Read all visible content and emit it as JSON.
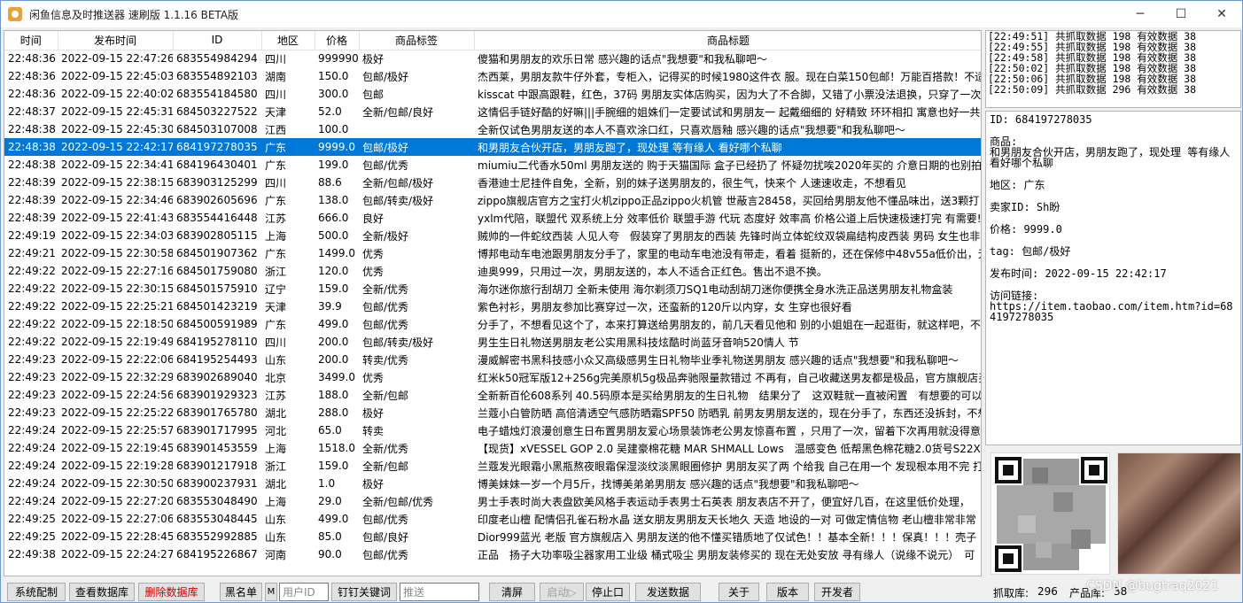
{
  "window": {
    "title": "闲鱼信息及时推送器 速刷版 1.1.16 BETA版",
    "controls": {
      "minimize": "─",
      "maximize": "☐",
      "close": "✕"
    }
  },
  "grid": {
    "columns": [
      "时间",
      "发布时间",
      "ID",
      "地区",
      "价格",
      "商品标签",
      "商品标题"
    ],
    "rows": [
      [
        "22:48:36",
        "2022-09-15 22:47:26",
        "683554984294",
        "四川",
        "999990",
        "极好",
        "傻猫和男朋友的欢乐日常 感兴趣的话点\"我想要\"和我私聊吧～"
      ],
      [
        "22:48:36",
        "2022-09-15 22:45:03",
        "683554892103",
        "湖南",
        "150.0",
        "包邮/极好",
        "杰西莱，男朋友款牛仔外套，专柜入，记得买的时候1980这件衣 服。现在白菜150包邮！万能百搭款！不适"
      ],
      [
        "22:48:36",
        "2022-09-15 22:40:02",
        "683554184580",
        "四川",
        "300.0",
        "包邮",
        "kisscat 中跟高跟鞋，红色，37码 男朋友实体店购买，因为大了不合脚，又错了小票没法退换，只穿了一次"
      ],
      [
        "22:48:37",
        "2022-09-15 22:45:31",
        "684503227522",
        "天津",
        "52.0",
        "全新/包邮/良好",
        "这情侣手链好酷的好嘛|||手腕细的姐姝们一定要试试和男朋友一 起戴细细的 好精致 环环相扣 寓意也好一共"
      ],
      [
        "22:48:38",
        "2022-09-15 22:45:30",
        "684503107008",
        "江西",
        "100.0",
        "",
        "全新仅试色男朋友送的本人不喜欢涂口红，只喜欢唇釉 感兴趣的话点\"我想要\"和我私聊吧～"
      ],
      [
        "22:48:38",
        "2022-09-15 22:42:17",
        "684197278035",
        "广东",
        "9999.0",
        "包邮/极好",
        "和男朋友合伙开店，男朋友跑了，现处理 等有缘人 看好哪个私聊"
      ],
      [
        "22:48:38",
        "2022-09-15 22:34:41",
        "684196430401",
        "广东",
        "199.0",
        "包邮/优秀",
        "miumiu二代香水50ml 男朋友送的 购于天猫国际 盒子已经扔了 怀疑勿扰唉2020年买的 介意日期的也别拍!"
      ],
      [
        "22:48:39",
        "2022-09-15 22:38:15",
        "683903125299",
        "四川",
        "88.6",
        "全新/包邮/极好",
        "香港迪士尼挂件自免，全新，别的妹子送男朋友的，很生气，快来个 人速速收走，不想看见"
      ],
      [
        "22:48:39",
        "2022-09-15 22:34:46",
        "683902605696",
        "广东",
        "138.0",
        "包邮/转卖/极好",
        "zippo旗舰店官方之宝打火机zippo正品zippo火机管 世蔽言28458，买回给男朋友他不懂品味出，送3颗打"
      ],
      [
        "22:48:39",
        "2022-09-15 22:41:43",
        "683554416448",
        "江苏",
        "666.0",
        "良好",
        "yxlm代陪，联盟代 双系统上分 效率低价 联盟手游 代玩 态度好 效率高 价格公道上后快速极速打完 有需要!"
      ],
      [
        "22:49:19",
        "2022-09-15 22:34:03",
        "683902805115",
        "上海",
        "500.0",
        "全新/极好",
        "贼帅的一件蛇纹西装 人见人夸　假装穿了男朋友的西装 先锋时尚立体蛇纹双袋扁结构皮西装 男码 女生也非"
      ],
      [
        "22:49:21",
        "2022-09-15 22:30:58",
        "684501907362",
        "广东",
        "1499.0",
        "优秀",
        "博邦电动车电池跟男朋友分手了，家里的电动车电池没有带走，看着 挺新的，还在保修中48v55a低价出，无"
      ],
      [
        "22:49:22",
        "2022-09-15 22:27:16",
        "684501759080",
        "浙江",
        "120.0",
        "优秀",
        "迪奥999，只用过一次，男朋友送的，本人不适合正红色。售出不退不换。"
      ],
      [
        "22:49:22",
        "2022-09-15 22:30:15",
        "684501575910",
        "辽宁",
        "159.0",
        "全新/优秀",
        "海尔迷你旅行刮胡刀 全新未使用 海尔剃须刀SQ1电动刮胡刀迷你便携全身水洗正品送男朋友礼物盒装"
      ],
      [
        "22:49:22",
        "2022-09-15 22:25:21",
        "684501423219",
        "天津",
        "39.9",
        "包邮/优秀",
        "紫色衬衫，男朋友参加比赛穿过一次，还蛮新的120斤以内穿，女 生穿也很好看"
      ],
      [
        "22:49:22",
        "2022-09-15 22:18:50",
        "684500591989",
        "广东",
        "499.0",
        "包邮/优秀",
        "分手了，不想看见这个了，本来打算送给男朋友的，前几天看见他和 别的小姐姐在一起逛街，就这样吧，不"
      ],
      [
        "22:49:22",
        "2022-09-15 22:19:49",
        "684195278110",
        "四川",
        "200.0",
        "包邮/转卖/极好",
        "男生生日礼物送男朋友老公实用黑科技炫酷时尚蓝牙音响520情人 节"
      ],
      [
        "22:49:23",
        "2022-09-15 22:22:06",
        "684195254493",
        "山东",
        "200.0",
        "转卖/优秀",
        "漫威解密书黑科技感小众又高级感男生日礼物毕业季礼物送男朋友 感兴趣的话点\"我想要\"和我私聊吧～"
      ],
      [
        "22:49:23",
        "2022-09-15 22:32:29",
        "683902689040",
        "北京",
        "3499.0",
        "优秀",
        "红米k50冠军版12+256g完美原机5g极品奔驰限量款错过 不再有，自己收藏送男友都是极品，官方旗舰店买"
      ],
      [
        "22:49:23",
        "2022-09-15 22:24:56",
        "683901929323",
        "江苏",
        "188.0",
        "全新/包邮",
        "全新新百伦608系列 40.5码原本是买给男朋友的生日礼物　结果分了　这双鞋就一直被闲置　有想要的可以私"
      ],
      [
        "22:49:23",
        "2022-09-15 22:25:22",
        "683901765780",
        "湖北",
        "288.0",
        "极好",
        "兰蔻小白管防晒 高倍清透空气感防晒霜SPF50 防晒乳 前男友男朋友送的，现在分手了，东西还没拆封，不想"
      ],
      [
        "22:49:24",
        "2022-09-15 22:25:57",
        "683901717995",
        "河北",
        "65.0",
        "转卖",
        "电子蜡烛灯浪漫创意生日布置男朋友爱心场景装饰老公男友惊喜布置 ，只用了一次，留着下次再用就没得意"
      ],
      [
        "22:49:24",
        "2022-09-15 22:19:45",
        "683901453559",
        "上海",
        "1518.0",
        "全新/优秀",
        "【现货】xVESSEL GOP 2.0 吴建豪棉花糖 MAR SHMALL Lows　温感变色 低帮黑色棉花糖2.0货号S22X55"
      ],
      [
        "22:49:24",
        "2022-09-15 22:19:28",
        "683901217918",
        "浙江",
        "159.0",
        "全新/包邮",
        "兰蔻发光眼霜小黑瓶熬夜眼霜保湿淡纹淡黑眼圈修护 男朋友买了两 个给我 自己在用一个 发现根本用不完 打"
      ],
      [
        "22:49:24",
        "2022-09-15 22:30:50",
        "683900237931",
        "湖北",
        "1.0",
        "极好",
        "博美妹妹一岁一个月5斤，找博美弟弟男朋友 感兴趣的话点\"我想要\"和我私聊吧～"
      ],
      [
        "22:49:24",
        "2022-09-15 22:27:20",
        "683553048490",
        "上海",
        "29.0",
        "全新/包邮/优秀",
        "男士手表时尚大表盘欧美风格手表运动手表男士石英表 朋友表店不开了，便宜好几百，在这里低价处理，"
      ],
      [
        "22:49:25",
        "2022-09-15 22:27:06",
        "683553048445",
        "山东",
        "499.0",
        "包邮/优秀",
        "印度老山檀 配情侣孔雀石粉水晶 送女朋友男朋友天长地久 天造 地设的一对 可做定情信物 老山檀非常非常"
      ],
      [
        "22:49:25",
        "2022-09-15 22:28:45",
        "683552992885",
        "山东",
        "85.0",
        "包邮/良好",
        "Dior999蓝光 老版 官方旗舰店入 男朋友送的他不懂买错质地了仅试色！！基本全新！！！保真！！！壳子"
      ],
      [
        "22:49:38",
        "2022-09-15 22:24:27",
        "684195226867",
        "河南",
        "90.0",
        "包邮/优秀",
        "正品　扬子大功率吸尘器家用工业级 桶式吸尘 男朋友装修买的 现在无处安放 寻有缘人（说缘不说元）　可"
      ]
    ],
    "selected_row": 5
  },
  "log": {
    "lines": [
      "[22:49:51] 共抓取数据 198 有效数据 38",
      "[22:49:55] 共抓取数据 198 有效数据 38",
      "[22:49:58] 共抓取数据 198 有效数据 38",
      "[22:50:02] 共抓取数据 198 有效数据 38",
      "[22:50:06] 共抓取数据 198 有效数据 38",
      "[22:50:09] 共抓取数据 296 有效数据 38"
    ]
  },
  "detail": {
    "id_line": "ID: 684197278035",
    "product_label": "商品:",
    "product_text": "和男朋友合伙开店，男朋友跑了，现处理 等有缘人 看好哪个私聊",
    "region_line": "地区: 广东",
    "seller_line": "卖家ID: Sh盼",
    "price_line": "价格: 9999.0",
    "tag_line": "tag: 包邮/极好",
    "publish_line": "发布时间: 2022-09-15 22:42:17",
    "link_label": "访问链接:",
    "link_url": "https://item.taobao.com/item.htm?id=684197278035"
  },
  "toolbar": {
    "sys_config": "系统配制",
    "view_db": "查看数据库",
    "delete_db": "删除数据库",
    "blacklist": "黑名单",
    "m_label": "M",
    "user_id_placeholder": "用户ID",
    "dingding_keywords": "钉钉关键词",
    "push_placeholder": "推送",
    "clear_screen": "清屏",
    "start": "启动▷",
    "stop": "停止口",
    "send_data": "发送数据",
    "about": "关于",
    "version": "版本",
    "developer": "开发者"
  },
  "status": {
    "crawl_label": "抓取库:",
    "crawl_count": "296",
    "product_label": "产品库:",
    "product_count": "38"
  },
  "watermark": "CSDN @bugtraq2021",
  "colors": {
    "selection": "#0078d7",
    "danger": "#d00000",
    "disabled": "#a0a0a0"
  }
}
